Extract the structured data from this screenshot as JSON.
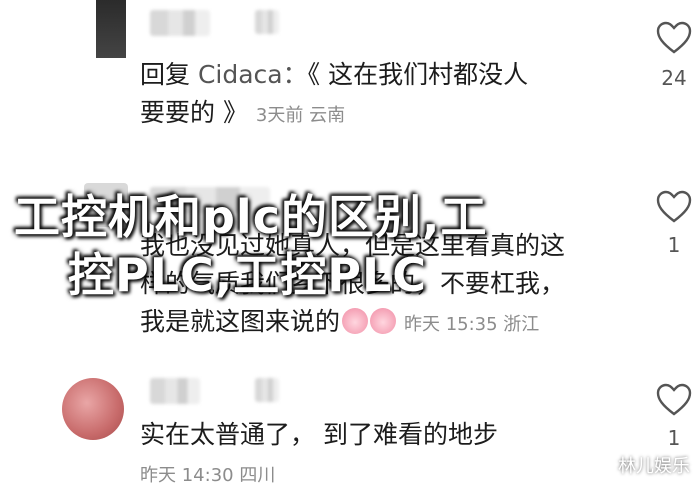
{
  "comments": [
    {
      "reply_label": "回复",
      "reply_to": "Cidaca：",
      "text": "《 这在我们村都没人要要的 》",
      "text_line1": "《 这在我们村都没人",
      "text_line2": "要要的 》",
      "meta": "3天前 云南",
      "likes": "24"
    },
    {
      "text_line1": "我也没见过她真人，但是这里看真的这",
      "text_line2": "样的气质我们乡下很多的，不要杠我，",
      "text_line3": "我是就这图来说的",
      "meta": "昨天 15:35 浙江",
      "likes": "1"
    },
    {
      "text_line1": "实在太普通了， 到了难看的地步",
      "meta": "昨天 14:30 四川",
      "likes": "1"
    }
  ],
  "overlay_title_line1": "工控机和plc的区别,工",
  "overlay_title_line2": "控PLC,工控PLC",
  "watermark": "林儿娱乐",
  "icons": {
    "like": "heart-outline-icon",
    "emoji": "pig-face-emoji-icon"
  },
  "colors": {
    "text": "#1c1c1c",
    "meta": "#8c8c8c",
    "heart_stroke": "#555555"
  }
}
